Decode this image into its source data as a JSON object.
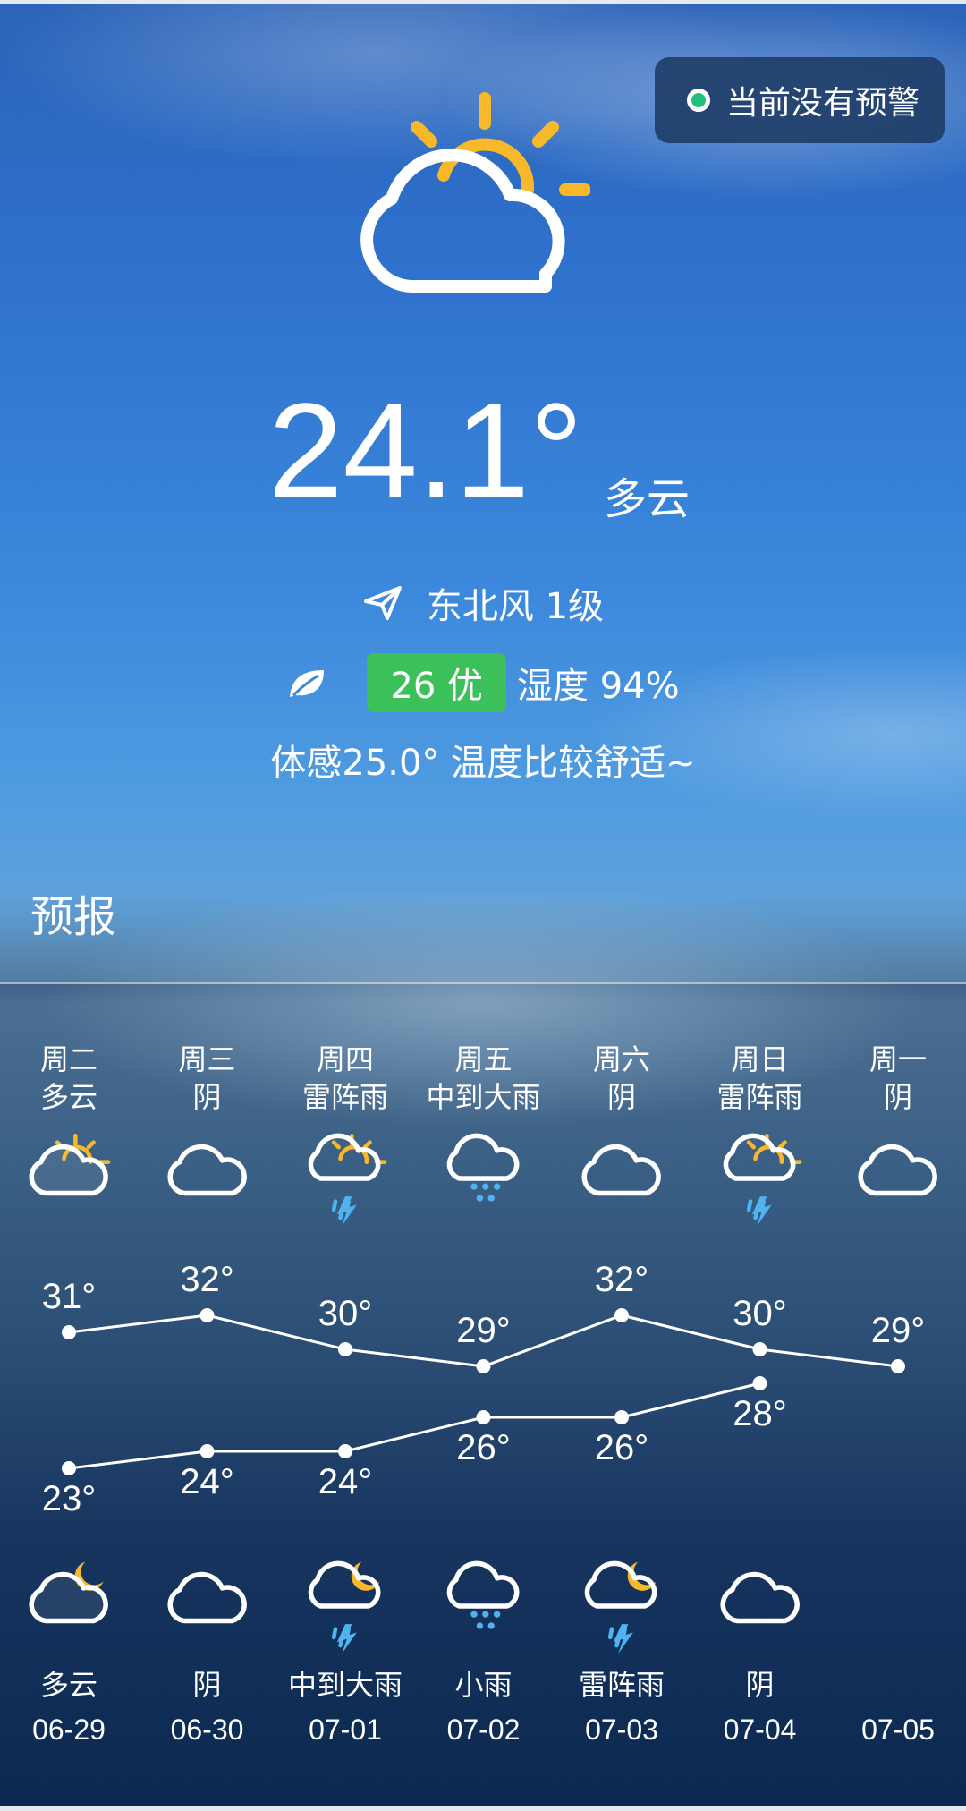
{
  "alert": {
    "text": "当前没有预警"
  },
  "current": {
    "temperature": "24.1°",
    "condition": "多云",
    "wind": "东北风 1级",
    "aqi": "26 优",
    "humidity": "湿度 94%",
    "feels_like": "体感25.0° 温度比较舒适~"
  },
  "forecast": {
    "title": "预报",
    "days": [
      {
        "weekday": "周二",
        "day_cond": "多云",
        "high": "31°",
        "low": "23°",
        "night_cond": "多云",
        "date": "06-29",
        "high_val": 31,
        "low_val": 23,
        "day_icon": "partly-cloudy-day-icon",
        "night_icon": "partly-cloudy-night-icon"
      },
      {
        "weekday": "周三",
        "day_cond": "阴",
        "high": "32°",
        "low": "24°",
        "night_cond": "阴",
        "date": "06-30",
        "high_val": 32,
        "low_val": 24,
        "day_icon": "cloudy-icon",
        "night_icon": "cloudy-icon"
      },
      {
        "weekday": "周四",
        "day_cond": "雷阵雨",
        "high": "30°",
        "low": "24°",
        "night_cond": "中到大雨",
        "date": "07-01",
        "high_val": 30,
        "low_val": 24,
        "day_icon": "thunderstorm-day-icon",
        "night_icon": "thunderstorm-night-icon"
      },
      {
        "weekday": "周五",
        "day_cond": "中到大雨",
        "high": "29°",
        "low": "26°",
        "night_cond": "小雨",
        "date": "07-02",
        "high_val": 29,
        "low_val": 26,
        "day_icon": "rain-icon",
        "night_icon": "rain-icon"
      },
      {
        "weekday": "周六",
        "day_cond": "阴",
        "high": "32°",
        "low": "26°",
        "night_cond": "雷阵雨",
        "date": "07-03",
        "high_val": 32,
        "low_val": 26,
        "day_icon": "cloudy-icon",
        "night_icon": "thunderstorm-night-icon"
      },
      {
        "weekday": "周日",
        "day_cond": "雷阵雨",
        "high": "30°",
        "low": "28°",
        "night_cond": "阴",
        "date": "07-04",
        "high_val": 30,
        "low_val": 28,
        "day_icon": "thunderstorm-day-icon",
        "night_icon": "cloudy-icon"
      },
      {
        "weekday": "周一",
        "day_cond": "阴",
        "high": "29°",
        "low": "",
        "night_cond": "",
        "date": "07-05",
        "high_val": 29,
        "low_val": null,
        "day_icon": "cloudy-icon",
        "night_icon": ""
      }
    ]
  },
  "colors": {
    "sun": "#f8b82a",
    "rain": "#4fb3f0",
    "aqi_good": "#3cc05a",
    "alert_dot": "#1fbf7e"
  }
}
